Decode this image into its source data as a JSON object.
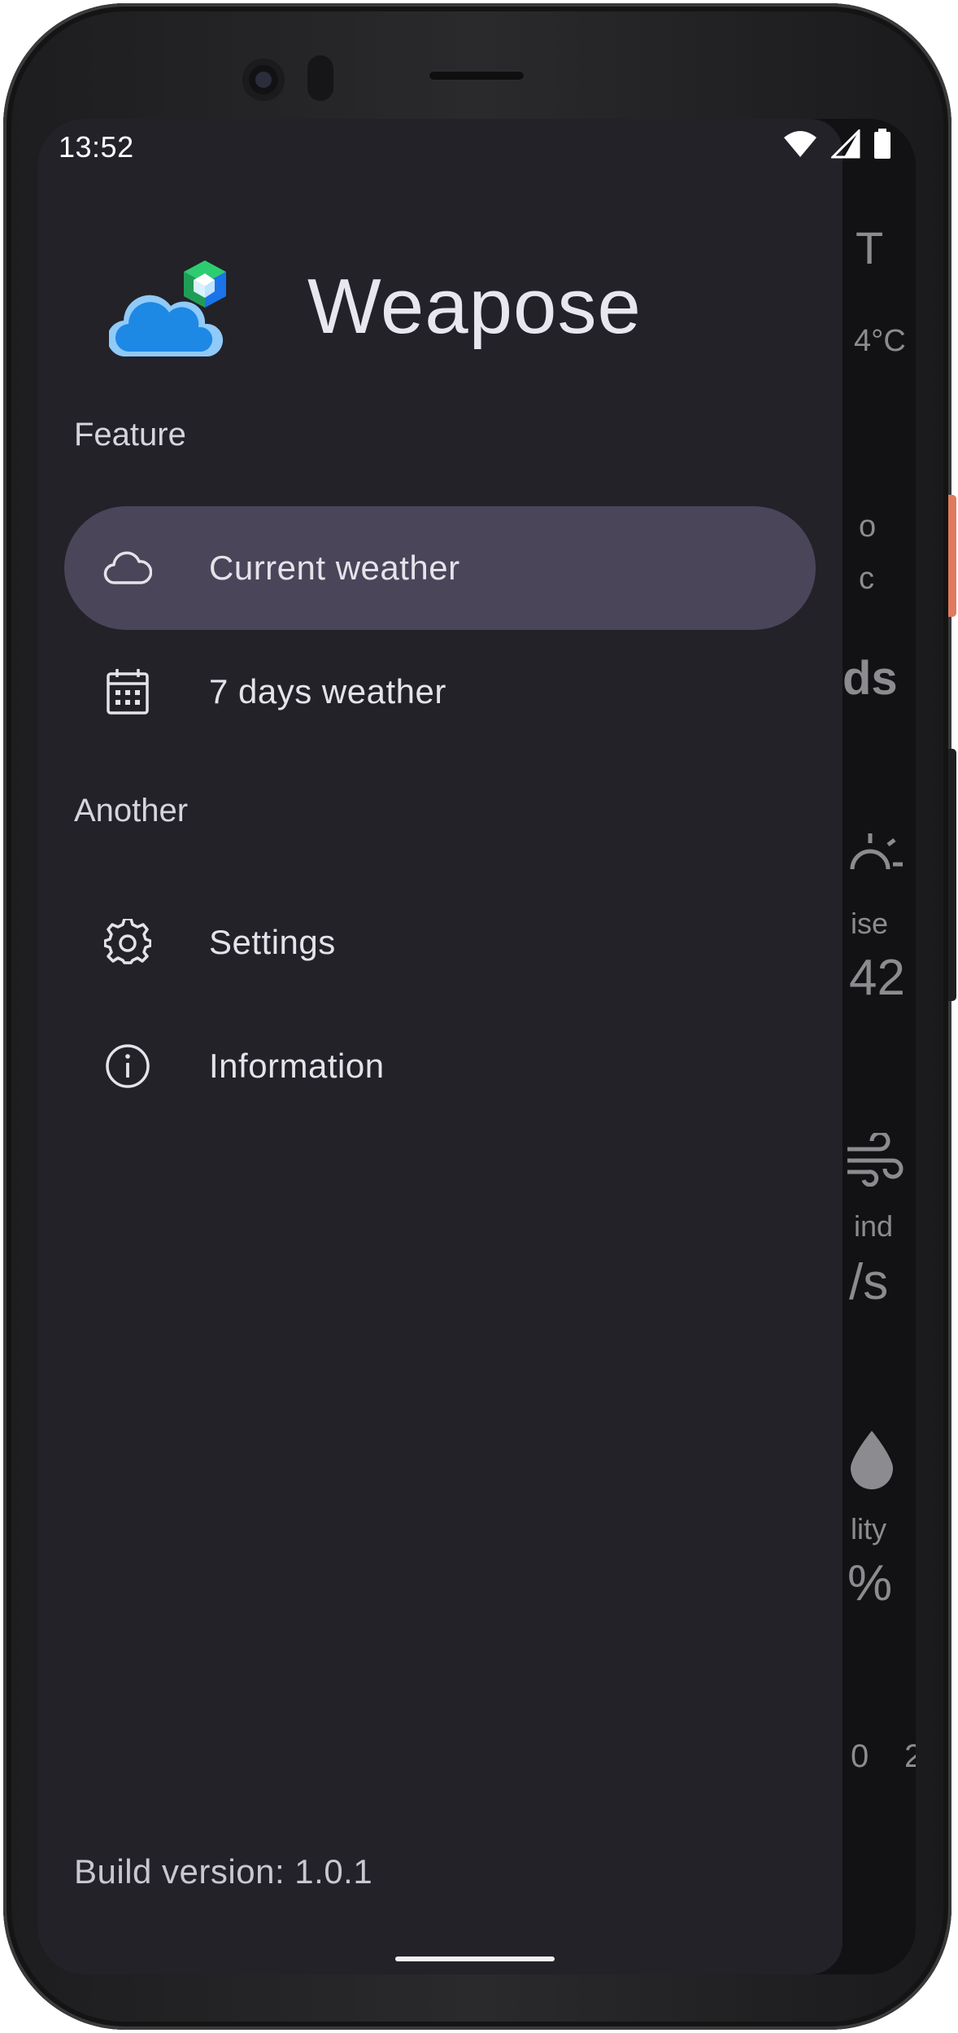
{
  "status_bar": {
    "time": "13:52"
  },
  "app": {
    "name": "Weapose"
  },
  "drawer": {
    "sections": [
      {
        "label": "Feature"
      },
      {
        "label": "Another"
      }
    ],
    "items": [
      {
        "label": "Current weather",
        "icon": "cloud-icon",
        "selected": true
      },
      {
        "label": "7 days weather",
        "icon": "calendar-icon",
        "selected": false
      },
      {
        "label": "Settings",
        "icon": "gear-icon",
        "selected": false
      },
      {
        "label": "Information",
        "icon": "info-icon",
        "selected": false
      }
    ],
    "build_version": "Build version: 1.0.1"
  },
  "background_screen": {
    "fragments": [
      "T",
      "4°C",
      "o",
      "c",
      "ds",
      "ise",
      "42",
      "ind",
      "/s",
      "lity",
      "%",
      "0",
      "2"
    ]
  },
  "colors": {
    "drawer_background": "#232229",
    "selected_item": "#4a4559",
    "text": "#e5e3ea"
  }
}
